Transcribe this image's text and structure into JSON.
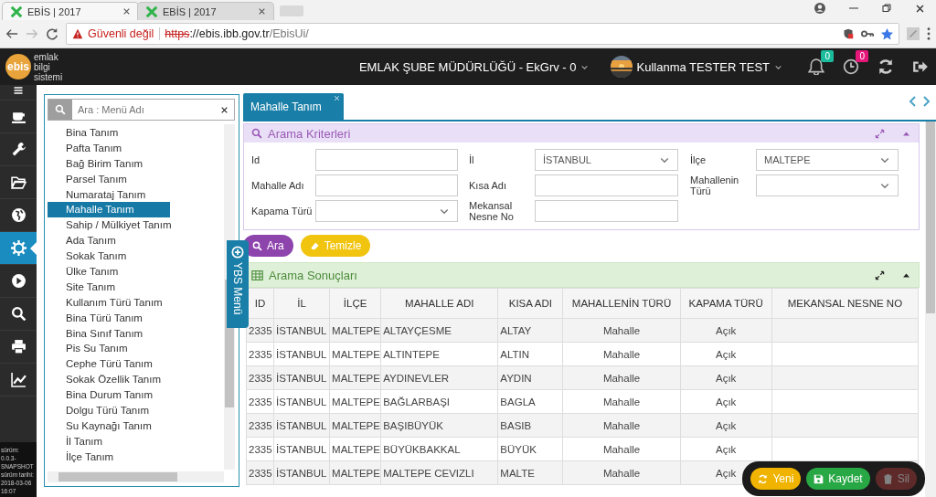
{
  "browser": {
    "tabs": [
      {
        "title": "EBİS | 2017",
        "selected": true
      },
      {
        "title": "EBİS | 2017",
        "selected": false
      }
    ],
    "security": "Güvenli değil",
    "url_scheme": "https",
    "url_host": "://ebis.ibb.gov.tr",
    "url_path": "/EbisUi/"
  },
  "app_header": {
    "logo": "ebis",
    "tagline": "emlak bilgi sistemi",
    "unit": "EMLAK ŞUBE MÜDÜRLÜĞÜ - EkGrv - 0",
    "user": "Kullanma TESTER TEST",
    "notifications": "0",
    "reminders": "0"
  },
  "icon_bar": {
    "items": [
      {
        "kind": "menu",
        "selected": false
      },
      {
        "kind": "cup",
        "selected": false
      },
      {
        "kind": "wrench",
        "selected": false
      },
      {
        "kind": "folder",
        "selected": false
      },
      {
        "kind": "globe",
        "selected": false
      },
      {
        "kind": "gear",
        "selected": true
      },
      {
        "kind": "play",
        "selected": false
      },
      {
        "kind": "search",
        "selected": false
      },
      {
        "kind": "print",
        "selected": false
      },
      {
        "kind": "chart",
        "selected": false
      }
    ],
    "version": "sürüm: 0.0.3-SNAPSHOT sürüm tarihi: 2018-03-06 16:07"
  },
  "menu": {
    "search_placeholder": "Ara : Menü Adı",
    "items": [
      {
        "label": "Bina Tanım",
        "selected": false
      },
      {
        "label": "Pafta Tanım",
        "selected": false
      },
      {
        "label": "Bağ Birim Tanım",
        "selected": false
      },
      {
        "label": "Parsel Tanım",
        "selected": false
      },
      {
        "label": "Numarataj Tanım",
        "selected": false
      },
      {
        "label": "Mahalle Tanım",
        "selected": true
      },
      {
        "label": "Sahip / Mülkiyet Tanım",
        "selected": false
      },
      {
        "label": "Ada Tanım",
        "selected": false
      },
      {
        "label": "Sokak Tanım",
        "selected": false
      },
      {
        "label": "Ülke Tanım",
        "selected": false
      },
      {
        "label": "Site Tanım",
        "selected": false
      },
      {
        "label": "Kullanım Türü Tanım",
        "selected": false
      },
      {
        "label": "Bina Türü Tanım",
        "selected": false
      },
      {
        "label": "Bina Sınıf Tanım",
        "selected": false
      },
      {
        "label": "Pis Su Tanım",
        "selected": false
      },
      {
        "label": "Cephe Türü Tanım",
        "selected": false
      },
      {
        "label": "Sokak Özellik Tanım",
        "selected": false
      },
      {
        "label": "Bina Durum Tanım",
        "selected": false
      },
      {
        "label": "Dolgu Türü Tanım",
        "selected": false
      },
      {
        "label": "Su Kaynağı Tanım",
        "selected": false
      },
      {
        "label": "İl Tanım",
        "selected": false
      },
      {
        "label": "İlçe Tanım",
        "selected": false
      }
    ]
  },
  "side_tab": "YBS Menü",
  "tabs": [
    {
      "label": "Mahalle Tanım",
      "selected": true
    }
  ],
  "criteria": {
    "title": "Arama Kriterleri",
    "fields": [
      {
        "label": "Id",
        "kind": "text"
      },
      {
        "label": "İl",
        "kind": "select",
        "value": "İSTANBUL"
      },
      {
        "label": "İlçe",
        "kind": "select",
        "value": "MALTEPE"
      },
      {
        "label": "Mahalle Adı",
        "kind": "text"
      },
      {
        "label": "Kısa Adı",
        "kind": "text"
      },
      {
        "label": "Mahallenin Türü",
        "kind": "select"
      },
      {
        "label": "Kapama Türü",
        "kind": "select"
      },
      {
        "label": "Mekansal Nesne No",
        "kind": "text"
      }
    ]
  },
  "buttons": [
    {
      "label": "Ara",
      "kind": "search"
    },
    {
      "label": "Temizle",
      "kind": "clear"
    }
  ],
  "results": {
    "title": "Arama Sonuçları",
    "columns": [
      "ID",
      "İL",
      "İLÇE",
      "MAHALLE ADI",
      "KISA ADI",
      "MAHALLENİN TÜRÜ",
      "KAPAMA TÜRÜ",
      "MEKANSAL NESNE NO"
    ],
    "rows": [
      [
        "2335",
        "İSTANBUL",
        "MALTEPE",
        "ALTAYÇESME",
        "ALTAY",
        "Mahalle",
        "Açık"
      ],
      [
        "2335",
        "İSTANBUL",
        "MALTEPE",
        "ALTINTEPE",
        "ALTIN",
        "Mahalle",
        "Açık"
      ],
      [
        "2335",
        "İSTANBUL",
        "MALTEPE",
        "AYDINEVLER",
        "AYDIN",
        "Mahalle",
        "Açık"
      ],
      [
        "2335",
        "İSTANBUL",
        "MALTEPE",
        "BAĞLARBAŞI",
        "BAGLA",
        "Mahalle",
        "Açık"
      ],
      [
        "2335",
        "İSTANBUL",
        "MALTEPE",
        "BAŞIBÜYÜK",
        "BASIB",
        "Mahalle",
        "Açık"
      ],
      [
        "2335",
        "İSTANBUL",
        "MALTEPE",
        "BÜYÜKBAKKAL",
        "BÜYÜK",
        "Mahalle",
        "Açık"
      ],
      [
        "2335",
        "İSTANBUL",
        "MALTEPE",
        "MALTEPE CEVIZLI",
        "MALTE",
        "Mahalle",
        "Açık"
      ]
    ]
  },
  "actions": [
    {
      "label": "Yeni",
      "kind": "new",
      "disabled": false
    },
    {
      "label": "Kaydet",
      "kind": "save",
      "disabled": false
    },
    {
      "label": "Sil",
      "kind": "delete",
      "disabled": true
    }
  ]
}
